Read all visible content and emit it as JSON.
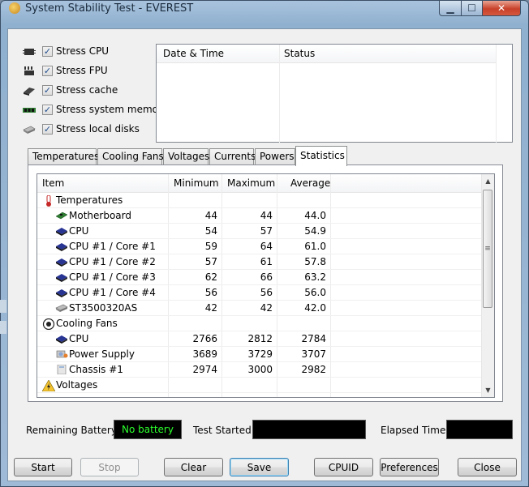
{
  "window": {
    "title": "System Stability Test - EVEREST"
  },
  "colors": {
    "accent": "#3c7fb1",
    "status_text": "#2cff2c",
    "close_button": "#c8412a"
  },
  "stress": [
    {
      "label": "Stress CPU",
      "checked": true,
      "icon": "cpu-chip-icon"
    },
    {
      "label": "Stress FPU",
      "checked": true,
      "icon": "fpu-icon"
    },
    {
      "label": "Stress cache",
      "checked": true,
      "icon": "cache-chip-icon"
    },
    {
      "label": "Stress system memory",
      "checked": true,
      "icon": "memory-module-icon"
    },
    {
      "label": "Stress local disks",
      "checked": true,
      "icon": "hard-disk-icon"
    }
  ],
  "check_glyph": "✓",
  "log": {
    "col_datetime": "Date & Time",
    "col_status": "Status"
  },
  "tabs": [
    {
      "label": "Temperatures",
      "active": false
    },
    {
      "label": "Cooling Fans",
      "active": false
    },
    {
      "label": "Voltages",
      "active": false
    },
    {
      "label": "Currents",
      "active": false
    },
    {
      "label": "Powers",
      "active": false
    },
    {
      "label": "Statistics",
      "active": true
    }
  ],
  "grid": {
    "headers": {
      "item": "Item",
      "min": "Minimum",
      "max": "Maximum",
      "avg": "Average"
    },
    "rows": [
      {
        "type": "group",
        "icon": "thermometer-icon",
        "item": "Temperatures"
      },
      {
        "type": "item",
        "icon": "motherboard-icon",
        "item": "Motherboard",
        "min": "44",
        "max": "44",
        "avg": "44.0"
      },
      {
        "type": "item",
        "icon": "cpu-chip-icon",
        "item": "CPU",
        "min": "54",
        "max": "57",
        "avg": "54.9"
      },
      {
        "type": "item",
        "icon": "cpu-chip-icon",
        "item": "CPU #1 / Core #1",
        "min": "59",
        "max": "64",
        "avg": "61.0"
      },
      {
        "type": "item",
        "icon": "cpu-chip-icon",
        "item": "CPU #1 / Core #2",
        "min": "57",
        "max": "61",
        "avg": "57.8"
      },
      {
        "type": "item",
        "icon": "cpu-chip-icon",
        "item": "CPU #1 / Core #3",
        "min": "62",
        "max": "66",
        "avg": "63.2"
      },
      {
        "type": "item",
        "icon": "cpu-chip-icon",
        "item": "CPU #1 / Core #4",
        "min": "56",
        "max": "56",
        "avg": "56.0"
      },
      {
        "type": "item",
        "icon": "hard-disk-icon",
        "item": "ST3500320AS",
        "min": "42",
        "max": "42",
        "avg": "42.0"
      },
      {
        "type": "group",
        "icon": "fan-icon",
        "item": "Cooling Fans"
      },
      {
        "type": "item",
        "icon": "cpu-chip-icon",
        "item": "CPU",
        "min": "2766",
        "max": "2812",
        "avg": "2784"
      },
      {
        "type": "item",
        "icon": "power-supply-icon",
        "item": "Power Supply",
        "min": "3689",
        "max": "3729",
        "avg": "3707"
      },
      {
        "type": "item",
        "icon": "chassis-icon",
        "item": "Chassis #1",
        "min": "2974",
        "max": "3000",
        "avg": "2982"
      },
      {
        "type": "group",
        "icon": "voltage-warning-icon",
        "item": "Voltages"
      }
    ]
  },
  "status": {
    "battery_label": "Remaining Battery:",
    "battery_value": "No battery",
    "started_label": "Test Started:",
    "started_value": "",
    "elapsed_label": "Elapsed Time:",
    "elapsed_value": ""
  },
  "buttons": {
    "start": "Start",
    "stop": "Stop",
    "clear": "Clear",
    "save": "Save",
    "cpuid": "CPUID",
    "preferences": "Preferences",
    "close": "Close"
  }
}
